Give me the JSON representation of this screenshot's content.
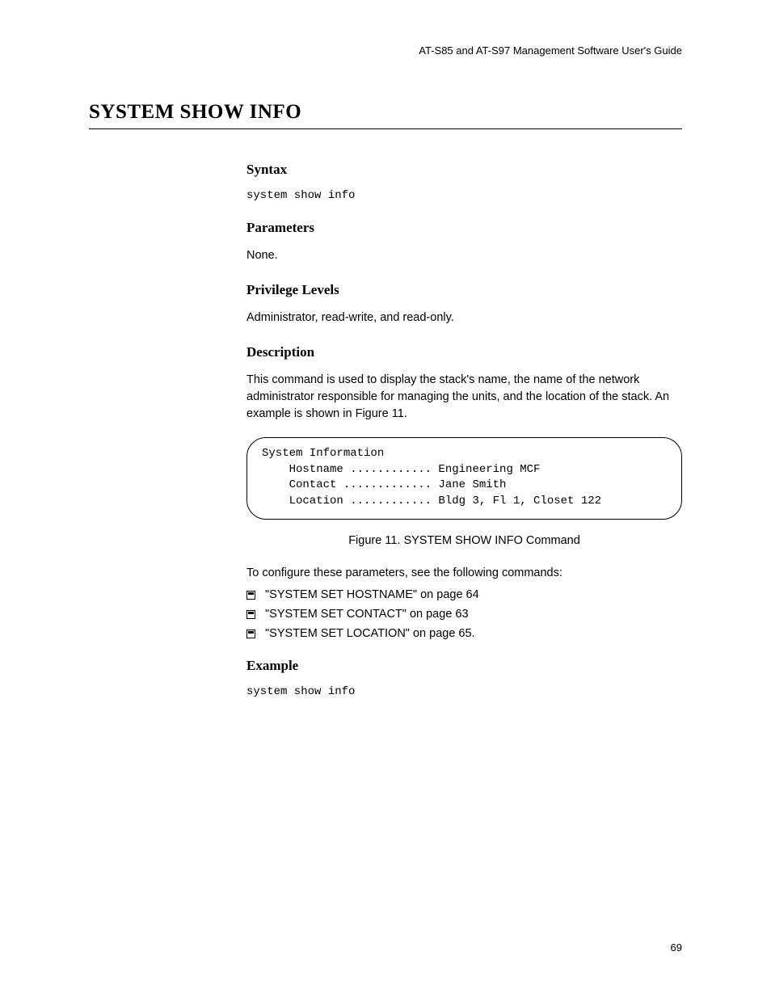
{
  "header": "AT-S85 and AT-S97 Management Software User's Guide",
  "title": "SYSTEM SHOW INFO",
  "sections": {
    "syntax": {
      "heading": "Syntax",
      "code": "system show info"
    },
    "parameters": {
      "heading": "Parameters",
      "text": "None."
    },
    "privilege": {
      "heading": "Privilege Levels",
      "text": "Administrator, read-write, and read-only."
    },
    "description": {
      "heading": "Description",
      "text": "This command is used to display the stack's name, the name of the network administrator responsible for managing the units, and the location of the stack. An example is shown in Figure 11."
    },
    "output": "System Information\n    Hostname ............ Engineering MCF\n    Contact ............. Jane Smith\n    Location ............ Bldg 3, Fl 1, Closet 122",
    "figure_caption": "Figure 11. SYSTEM SHOW INFO Command",
    "followup_text": "To configure these parameters, see the following commands:",
    "references": [
      "\"SYSTEM SET HOSTNAME\" on page 64",
      "\"SYSTEM SET CONTACT\" on page 63",
      "\"SYSTEM SET LOCATION\" on page 65."
    ],
    "example": {
      "heading": "Example",
      "code": "system show info"
    }
  },
  "page_number": "69"
}
